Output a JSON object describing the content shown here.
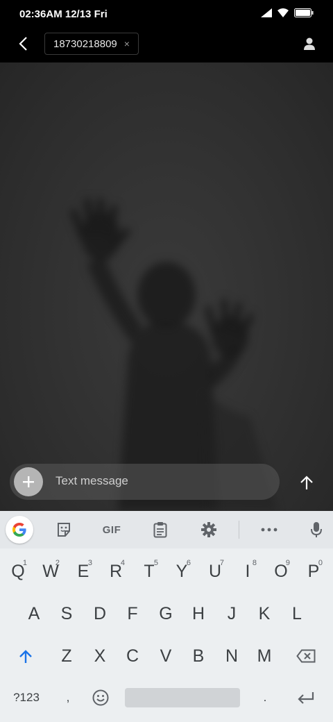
{
  "status_bar": {
    "time": "02:36AM 12/13 Fri"
  },
  "header": {
    "recipient": "18730218809",
    "chip_close": "×"
  },
  "compose": {
    "placeholder": "Text message"
  },
  "keyboard": {
    "toolbar": {
      "gif_label": "GIF"
    },
    "row1": [
      {
        "key": "Q",
        "hint": "1"
      },
      {
        "key": "W",
        "hint": "2"
      },
      {
        "key": "E",
        "hint": "3"
      },
      {
        "key": "R",
        "hint": "4"
      },
      {
        "key": "T",
        "hint": "5"
      },
      {
        "key": "Y",
        "hint": "6"
      },
      {
        "key": "U",
        "hint": "7"
      },
      {
        "key": "I",
        "hint": "8"
      },
      {
        "key": "O",
        "hint": "9"
      },
      {
        "key": "P",
        "hint": "0"
      }
    ],
    "row2": [
      "A",
      "S",
      "D",
      "F",
      "G",
      "H",
      "J",
      "K",
      "L"
    ],
    "row3": [
      "Z",
      "X",
      "C",
      "V",
      "B",
      "N",
      "M"
    ],
    "bottom": {
      "symbols": "?123",
      "comma": ",",
      "period": "."
    }
  }
}
